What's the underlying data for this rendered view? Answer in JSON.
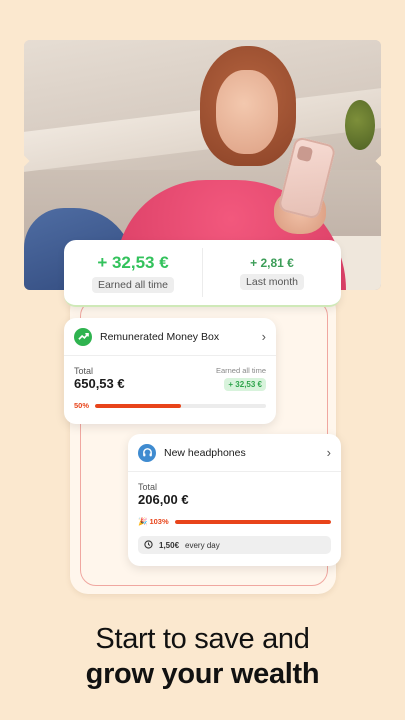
{
  "earnings": {
    "all_time_value": "+ 32,53 €",
    "all_time_label": "Earned all time",
    "month_value": "+ 2,81 €",
    "month_label": "Last month"
  },
  "money_box": {
    "title": "Remunerated Money Box",
    "total_label": "Total",
    "total_value": "650,53 €",
    "earned_label": "Earned all time",
    "earned_value": "+ 32,53 €",
    "progress_label": "50%",
    "progress": 0.5,
    "icon": "trend-up-icon"
  },
  "goal": {
    "title": "New headphones",
    "total_label": "Total",
    "total_value": "206,00 €",
    "progress_label": "103%",
    "progress": 1.0,
    "daily_amount": "1,50€",
    "daily_text": "every day",
    "icon": "headphones-icon"
  },
  "headline": {
    "line1": "Start to save and",
    "line2": "grow your wealth"
  },
  "colors": {
    "background": "#fbe8cf",
    "accent": "#e8441a",
    "positive": "#33c25c"
  }
}
